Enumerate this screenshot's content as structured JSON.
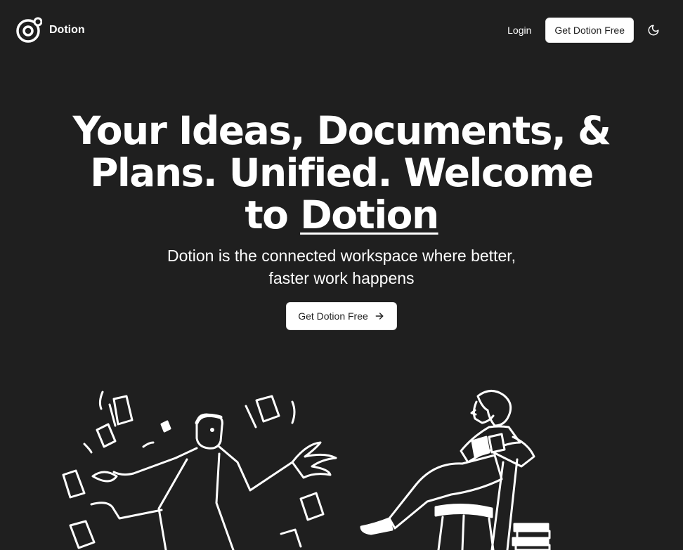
{
  "header": {
    "brand_name": "Dotion",
    "login_label": "Login",
    "cta_label": "Get Dotion Free"
  },
  "hero": {
    "headline_part1": "Your Ideas, Documents, & Plans. Unified. Welcome to ",
    "headline_brand": "Dotion",
    "subheadline": "Dotion is the connected workspace where better, faster work happens",
    "cta_label": "Get Dotion Free"
  },
  "icons": {
    "logo": "dotion-logo-icon",
    "theme_toggle": "moon-icon",
    "cta_arrow": "arrow-right-icon"
  },
  "colors": {
    "background": "#1f1f1f",
    "foreground": "#ffffff",
    "button_background": "#ffffff",
    "button_text": "#1f1f1f"
  }
}
